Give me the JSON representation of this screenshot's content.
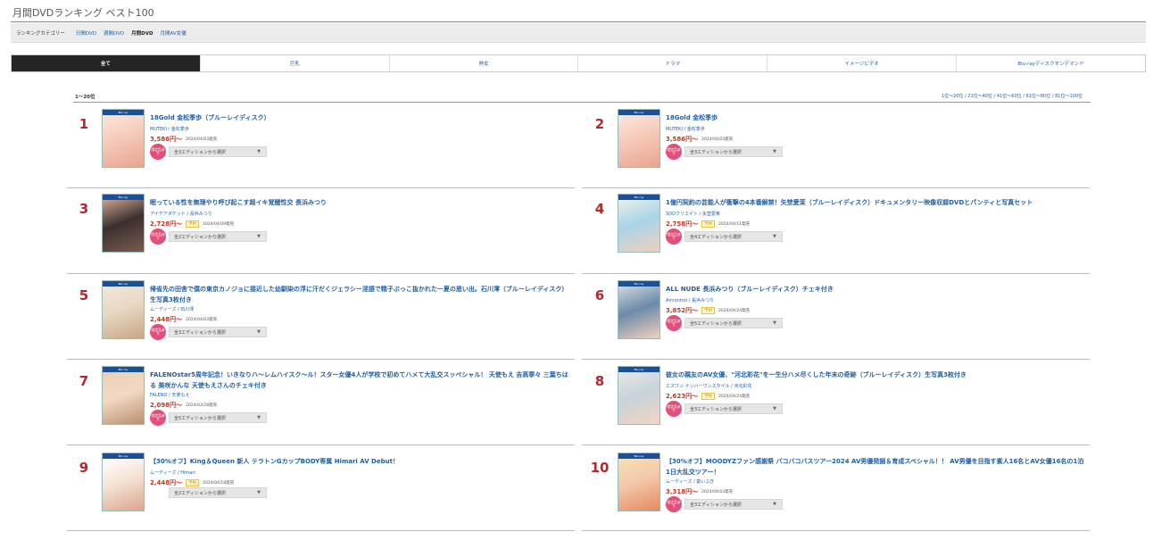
{
  "page": {
    "title": "月間DVDランキング ベスト100"
  },
  "category_bar": {
    "label": "ランキングカテゴリー",
    "links": [
      {
        "label": "日間DVD",
        "active": false
      },
      {
        "label": "週間DVD",
        "active": false
      },
      {
        "label": "月間DVD",
        "active": true
      },
      {
        "label": "月間AV女優",
        "active": false
      }
    ]
  },
  "tabs": [
    {
      "label": "全て",
      "active": true
    },
    {
      "label": "巨乳",
      "active": false
    },
    {
      "label": "熟女",
      "active": false
    },
    {
      "label": "ドラマ",
      "active": false
    },
    {
      "label": "イメージビデオ",
      "active": false
    },
    {
      "label": "Blu-rayディスクオンデマンド",
      "active": false
    }
  ],
  "range": {
    "label": "1～20位",
    "pager": "1位～20位 / 21位～40位 / 41位～60位 / 61位～80位 / 81位～100位"
  },
  "badge_text": "限定品あり",
  "bluray_label": "Blu-ray",
  "items": [
    {
      "rank": "1",
      "title": "18Gold 金松季歩（ブルーレイディスク）",
      "maker": "MUTEKI / 金松季歩",
      "price": "3,586円～",
      "preorder": "",
      "release": "2024/04/03発売",
      "edition": "全3エディションから選択",
      "badge": true
    },
    {
      "rank": "2",
      "title": "18Gold 金松季歩",
      "maker": "MUTEKI / 金松季歩",
      "price": "3,586円～",
      "preorder": "",
      "release": "2024/04/03発売",
      "edition": "全3エディションから選択",
      "badge": true
    },
    {
      "rank": "3",
      "title": "眠っている性を無理やり呼び起こす超イキ覚醒性交 長浜みつり",
      "maker": "アイデアポケット / 長浜みつり",
      "price": "2,728円～",
      "preorder": "予約",
      "release": "2024/04/09発売",
      "edition": "全2エディションから選択",
      "badge": true
    },
    {
      "rank": "4",
      "title": "1億円契約の芸能人が衝撃の4本番解禁！矢埜愛茉（ブルーレイディスク）ドキュメンタリー映像収録DVDとパンティと写真セット",
      "maker": "SODクリエイト / 矢埜愛茉",
      "price": "2,758円～",
      "preorder": "予約",
      "release": "2024/04/11発売",
      "edition": "全4エディションから選択",
      "badge": true
    },
    {
      "rank": "5",
      "title": "帰省先の田舎で僕の東京カノジョに接近した幼馴染の浮に汗だくジェラシー淫語で精子ぶっこ抜かれた一夏の思い出。石川澪（ブルーレイディスク）生写真3枚付き",
      "maker": "ムーディーズ / 石川澪",
      "price": "2,448円～",
      "preorder": "",
      "release": "2024/04/03発売",
      "edition": "全3エディションから選択",
      "badge": true
    },
    {
      "rank": "6",
      "title": "ALL NUDE 長浜みつり（ブルーレイディスク）チェキ付き",
      "maker": "Aircontrol / 長浜みつり",
      "price": "3,852円～",
      "preorder": "予約",
      "release": "2024/04/24発売",
      "edition": "全5エディションから選択",
      "badge": true
    },
    {
      "rank": "7",
      "title": "FALENOstar5周年記念！いきなりハ～レムハイスク～ル！スター女優4人が学校で初めてハメて大乱交スッペシャル！ 天使もえ 吉高寧々 三葉ちはる 美咲かんな 天使もえさんのチェキ付き",
      "maker": "FALENO / 天使もえ",
      "price": "2,098円～",
      "preorder": "",
      "release": "2024/03/28発売",
      "edition": "全5エディションから選択",
      "badge": true
    },
    {
      "rank": "8",
      "title": "彼女の親友のAV女優、\"河北彩花\"を一生分ハメ尽くした年末の奇跡（ブルーレイディスク）生写真3枚付き",
      "maker": "エスワン ナンバーワンスタイル / 河北彩花",
      "price": "2,623円～",
      "preorder": "予約",
      "release": "2024/04/24発売",
      "edition": "全3エディションから選択",
      "badge": true
    },
    {
      "rank": "9",
      "title": "【30%オフ】King＆Queen 新人 テラトンGカップBODY専属 Himari AV Debut！",
      "maker": "ムーディーズ / Himari",
      "price": "2,448円～",
      "preorder": "予約",
      "release": "2024/04/18発売",
      "edition": "全2エディションから選択",
      "badge": false
    },
    {
      "rank": "10",
      "title": "【30%オフ】MOODYZファン感謝祭 バコバコバスツアー2024 AV男優発掘＆育成スペシャル！！ AV男優を目指す素人16名とAV女優16名の1泊1日大乱交ツアー！",
      "maker": "ムーディーズ / 葵いぶき",
      "price": "3,318円～",
      "preorder": "",
      "release": "2024/04/03発売",
      "edition": "全3エディションから選択",
      "badge": true
    }
  ]
}
